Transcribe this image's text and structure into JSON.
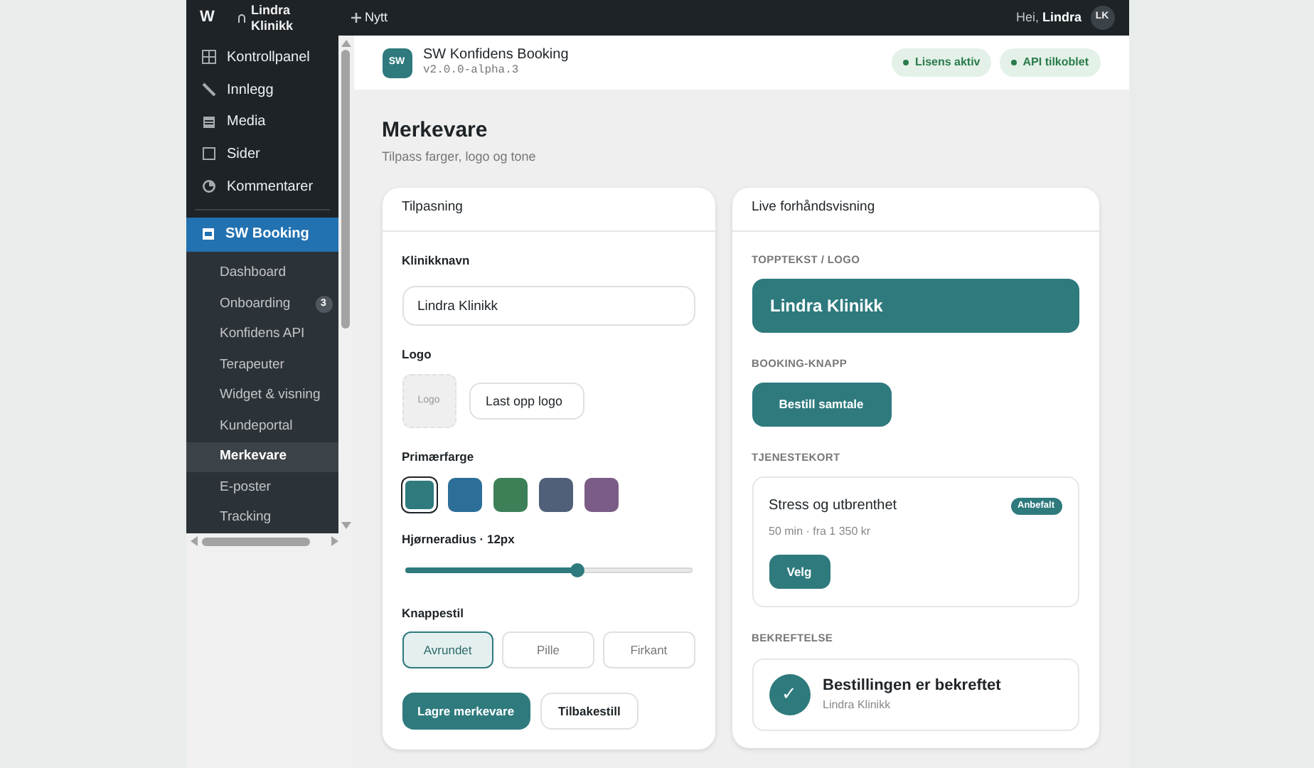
{
  "admin_bar": {
    "logo": "W",
    "site": "Lindra Klinikk",
    "new": "Nytt",
    "greeting": "Hei,",
    "user": "Lindra",
    "avatar": "LK"
  },
  "sidebar": {
    "items": [
      {
        "label": "Kontrollpanel"
      },
      {
        "label": "Innlegg"
      },
      {
        "label": "Media"
      },
      {
        "label": "Sider"
      },
      {
        "label": "Kommentarer"
      }
    ],
    "plugin": {
      "label": "SW Booking",
      "selected": true
    },
    "submenu": [
      {
        "label": "Dashboard",
        "selected": false
      },
      {
        "label": "Onboarding",
        "selected": false,
        "badge": "3"
      },
      {
        "label": "Konfidens API",
        "selected": false
      },
      {
        "label": "Terapeuter",
        "selected": false
      },
      {
        "label": "Widget & visning",
        "selected": false
      },
      {
        "label": "Kundeportal",
        "selected": false
      },
      {
        "label": "Merkevare",
        "selected": true
      },
      {
        "label": "E-poster",
        "selected": false
      },
      {
        "label": "Tracking",
        "selected": false
      }
    ]
  },
  "header": {
    "logo": "SW",
    "title": "SW Konfidens Booking",
    "version": "v2.0.0-alpha.3",
    "badges": [
      "Lisens aktiv",
      "API tilkoblet"
    ]
  },
  "page": {
    "title": "Merkevare",
    "subtitle": "Tilpass farger, logo og tone"
  },
  "customize": {
    "title": "Tilpasning",
    "name_label": "Klinikknavn",
    "name_value": "Lindra Klinikk",
    "logo_label": "Logo",
    "logo_placeholder": "Logo",
    "upload": "Last opp logo",
    "color_label": "Primærfarge",
    "colors": [
      {
        "color": "#2e7a7d",
        "selected": true
      },
      {
        "color": "#2d6e99",
        "selected": false
      },
      {
        "color": "#3d8058",
        "selected": false
      },
      {
        "color": "#4f6078",
        "selected": false
      },
      {
        "color": "#7b5c86",
        "selected": false
      }
    ],
    "radius_label": "Hjørneradius · 12px",
    "radius": {
      "level": 0.6
    },
    "style_label": "Knappestil",
    "styles": [
      {
        "label": "Avrundet",
        "selected": true
      },
      {
        "label": "Pille",
        "selected": false
      },
      {
        "label": "Firkant",
        "selected": false
      }
    ],
    "save": "Lagre merkevare",
    "reset": "Tilbakestill"
  },
  "preview": {
    "title": "Live forhåndsvisning",
    "header_label": "TOPPTEKST / LOGO",
    "header_text": "Lindra Klinikk",
    "button_label": "BOOKING-KNAPP",
    "button_text": "Bestill samtale",
    "card_label": "TJENESTEKORT",
    "card_title": "Stress og utbrenthet",
    "card_badge": "Anbefalt",
    "card_meta": "50 min · fra 1 350 kr",
    "card_button": "Velg",
    "confirm_label": "BEKREFTELSE",
    "confirm_mark": "✓",
    "confirm_title": "Bestillingen er bekreftet",
    "confirm_sub": "Lindra Klinikk"
  }
}
